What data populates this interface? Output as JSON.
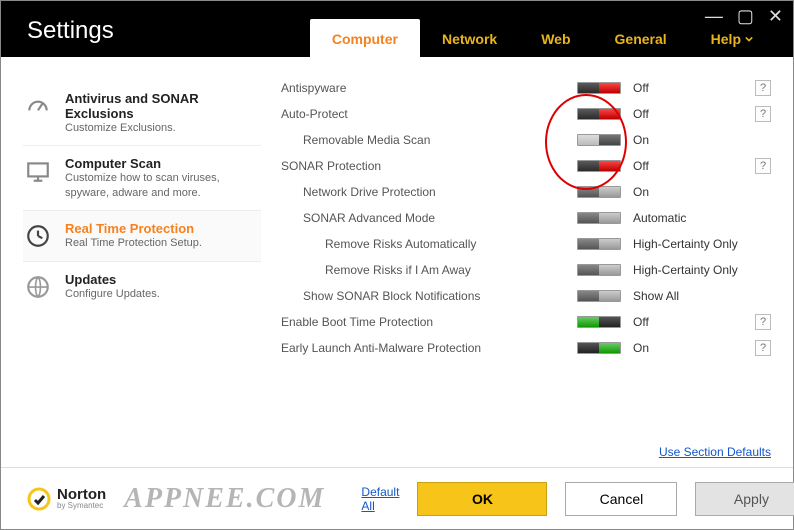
{
  "title": "Settings",
  "tabs": {
    "computer": "Computer",
    "network": "Network",
    "web": "Web",
    "general": "General",
    "help": "Help"
  },
  "sidebar": [
    {
      "title": "Antivirus and SONAR Exclusions",
      "sub": "Customize Exclusions."
    },
    {
      "title": "Computer Scan",
      "sub": "Customize how to scan viruses, spyware, adware and more."
    },
    {
      "title": "Real Time Protection",
      "sub": "Real Time Protection Setup."
    },
    {
      "title": "Updates",
      "sub": "Configure Updates."
    }
  ],
  "settings": [
    {
      "label": "Antispyware",
      "indent": 0,
      "toggle": "red-left",
      "value": "Off",
      "help": true
    },
    {
      "label": "Auto-Protect",
      "indent": 0,
      "toggle": "red-left",
      "value": "Off",
      "help": true
    },
    {
      "label": "Removable Media Scan",
      "indent": 1,
      "toggle": "gray",
      "value": "On",
      "help": false
    },
    {
      "label": "SONAR Protection",
      "indent": 0,
      "toggle": "red-left",
      "value": "Off",
      "help": true
    },
    {
      "label": "Network Drive Protection",
      "indent": 1,
      "toggle": "midgray",
      "value": "On",
      "help": false
    },
    {
      "label": "SONAR Advanced Mode",
      "indent": 1,
      "toggle": "midgray",
      "value": "Automatic",
      "help": false
    },
    {
      "label": "Remove Risks Automatically",
      "indent": 2,
      "toggle": "midgray",
      "value": "High-Certainty Only",
      "help": false
    },
    {
      "label": "Remove Risks if I Am Away",
      "indent": 2,
      "toggle": "midgray",
      "value": "High-Certainty Only",
      "help": false
    },
    {
      "label": "Show SONAR Block Notifications",
      "indent": 1,
      "toggle": "midgray",
      "value": "Show All",
      "help": false
    },
    {
      "label": "Enable Boot Time Protection",
      "indent": 0,
      "toggle": "green-left",
      "value": "Off",
      "help": true
    },
    {
      "label": "Early Launch Anti-Malware Protection",
      "indent": 0,
      "toggle": "green-right",
      "value": "On",
      "help": true
    }
  ],
  "links": {
    "section_defaults": "Use Section Defaults",
    "default_all": "Default All"
  },
  "buttons": {
    "ok": "OK",
    "cancel": "Cancel",
    "apply": "Apply"
  },
  "brand": {
    "name": "Norton",
    "sub": "by Symantec"
  },
  "watermark": "APPNEE.COM"
}
